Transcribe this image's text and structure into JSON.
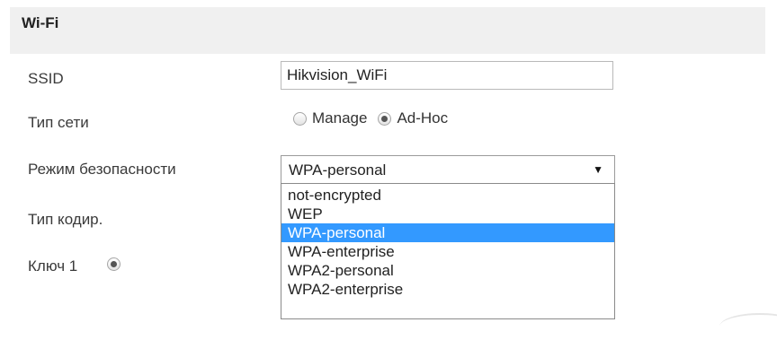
{
  "section": {
    "title": "Wi-Fi"
  },
  "ssid": {
    "label": "SSID",
    "value": "Hikvision_WiFi"
  },
  "network_type": {
    "label": "Тип сети",
    "options": [
      {
        "label": "Manage",
        "checked": false
      },
      {
        "label": "Ad-Hoc",
        "checked": true
      }
    ]
  },
  "security_mode": {
    "label": "Режим безопасности",
    "selected": "WPA-personal",
    "arrow_icon": "triangle-down",
    "options": [
      {
        "label": "not-encrypted"
      },
      {
        "label": "WEP"
      },
      {
        "label": "WPA-personal"
      },
      {
        "label": "WPA-enterprise"
      },
      {
        "label": "WPA2-personal"
      },
      {
        "label": "WPA2-enterprise"
      }
    ],
    "highlight_color": "#3399ff"
  },
  "encryption_type": {
    "label": "Тип кодир."
  },
  "key1": {
    "label": "Ключ 1",
    "checked": true
  }
}
